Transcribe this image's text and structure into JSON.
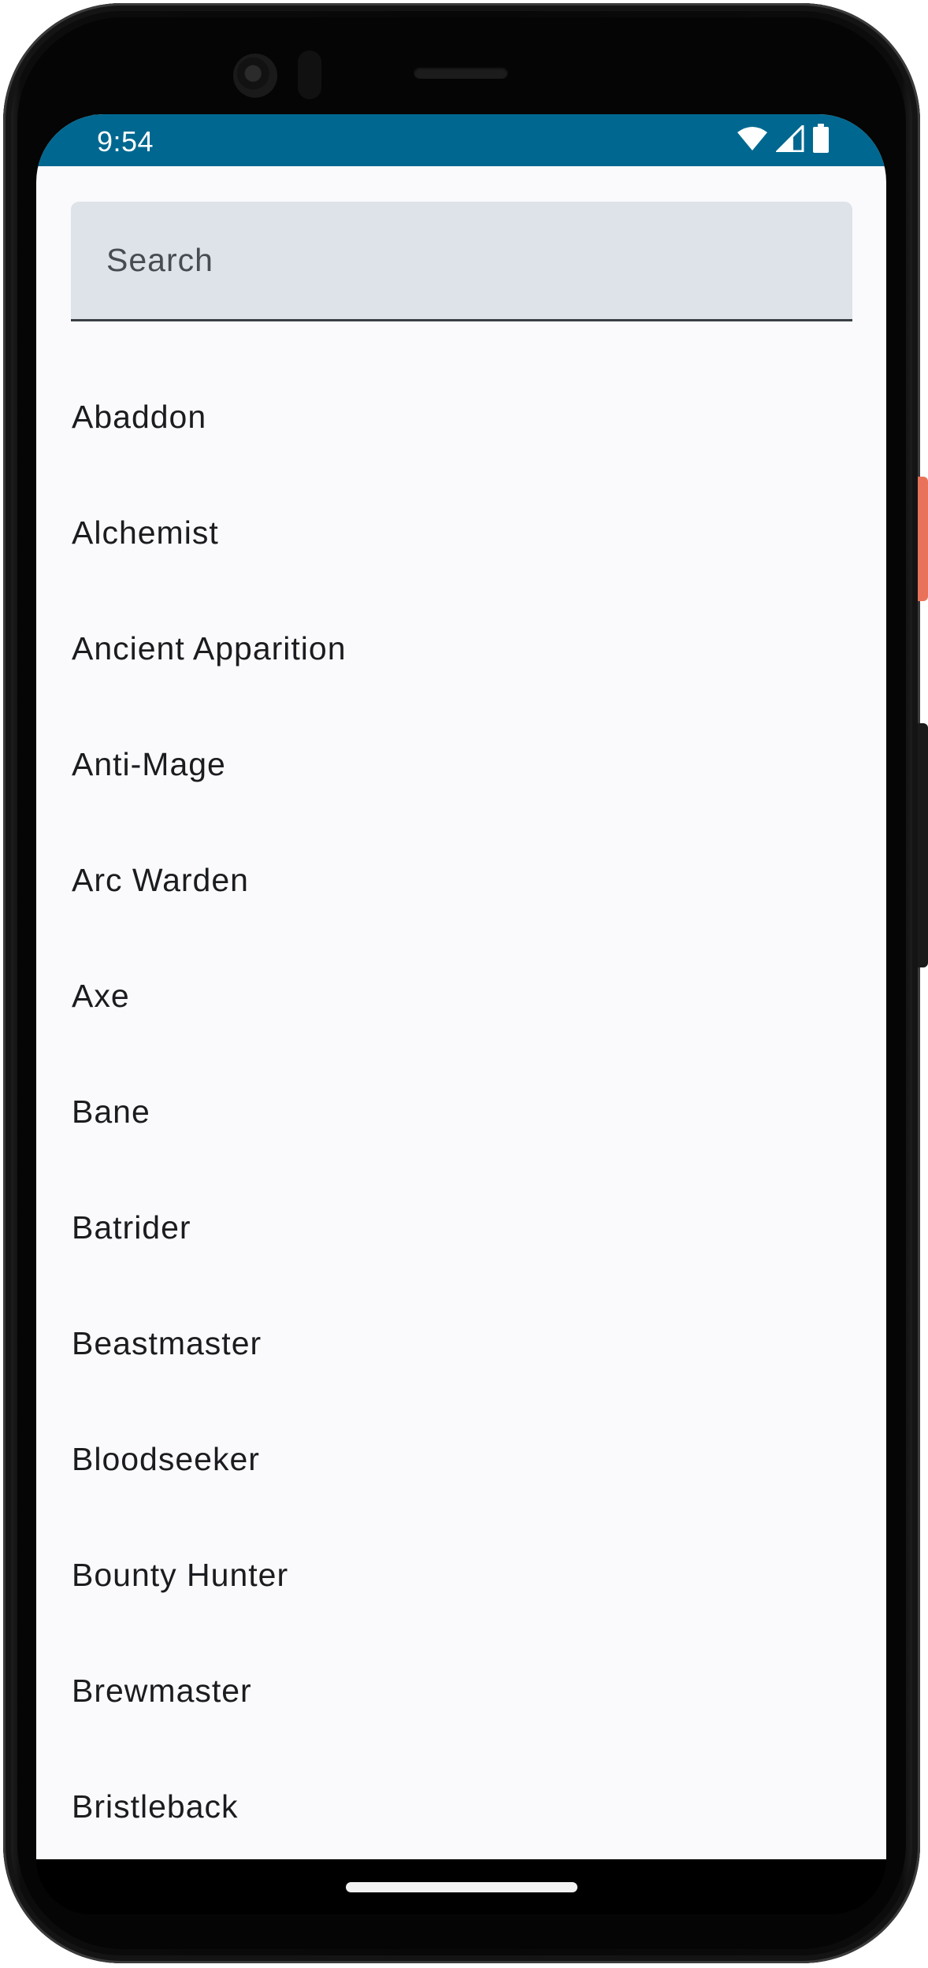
{
  "status_bar": {
    "time": "9:54",
    "background": "#006890",
    "icons": [
      "wifi-icon",
      "cellular-signal-icon",
      "battery-icon"
    ]
  },
  "search": {
    "placeholder": "Search",
    "value": ""
  },
  "heroes": [
    "Abaddon",
    "Alchemist",
    "Ancient Apparition",
    "Anti-Mage",
    "Arc Warden",
    "Axe",
    "Bane",
    "Batrider",
    "Beastmaster",
    "Bloodseeker",
    "Bounty Hunter",
    "Brewmaster",
    "Bristleback"
  ],
  "colors": {
    "screen_background": "#fafafc",
    "search_background": "#dde3e8",
    "text": "#1b1c1f",
    "side_button_accent": "#e9735a"
  }
}
